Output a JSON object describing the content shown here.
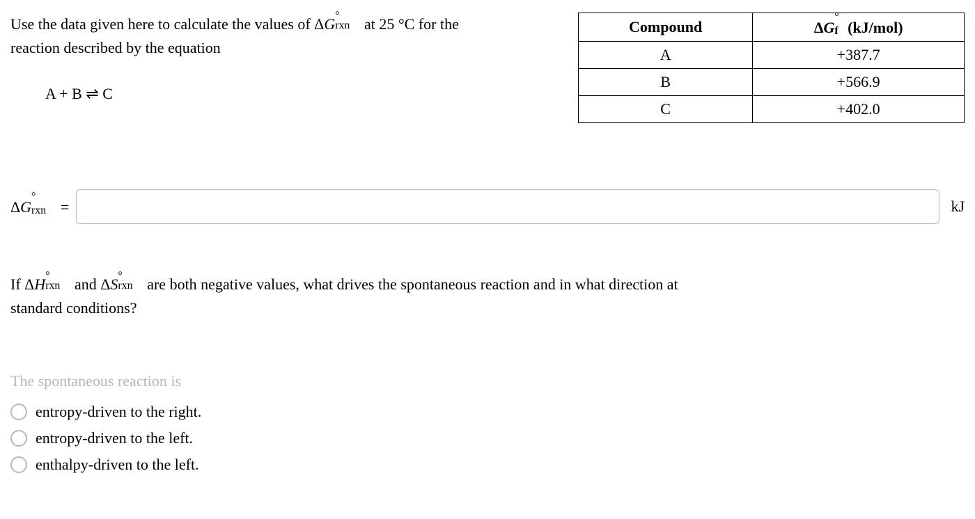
{
  "intro_line1": "Use the data given here to calculate the values of ",
  "intro_dg_part1": "Δ",
  "intro_dg_G": "G",
  "intro_dg_sup": "°",
  "intro_dg_sub": "rxn",
  "intro_line1b": " at 25 °C for the",
  "intro_line2": "reaction described by the equation",
  "equation": "A + B ⇌ C",
  "table": {
    "head_compound": "Compound",
    "head_dg_part1": "Δ",
    "head_dg_G": "G",
    "head_dg_sup": "°",
    "head_dg_sub": "f",
    "head_dg_unit": " (kJ/mol)",
    "rows": [
      {
        "compound": "A",
        "value": "+387.7"
      },
      {
        "compound": "B",
        "value": "+566.9"
      },
      {
        "compound": "C",
        "value": "+402.0"
      }
    ]
  },
  "answer_label_part1": "Δ",
  "answer_label_G": "G",
  "answer_label_sup": "°",
  "answer_label_sub": "rxn",
  "answer_label_eq": " =",
  "answer_value": "",
  "answer_unit": "kJ",
  "q2_pref": "If ",
  "q2_dh_part1": "Δ",
  "q2_dh_H": "H",
  "q2_dh_sup": "°",
  "q2_dh_sub": "rxn",
  "q2_and": " and ",
  "q2_ds_part1": "Δ",
  "q2_ds_S": "S",
  "q2_ds_sup": "°",
  "q2_ds_sub": "rxn",
  "q2_mid": " are both negative values, what drives the spontaneous reaction and in what direction at",
  "q2_line2": "standard conditions?",
  "prompt": "The spontaneous reaction is",
  "options": [
    "entropy-driven to the right.",
    "entropy-driven to the left.",
    "enthalpy-driven to the left."
  ]
}
